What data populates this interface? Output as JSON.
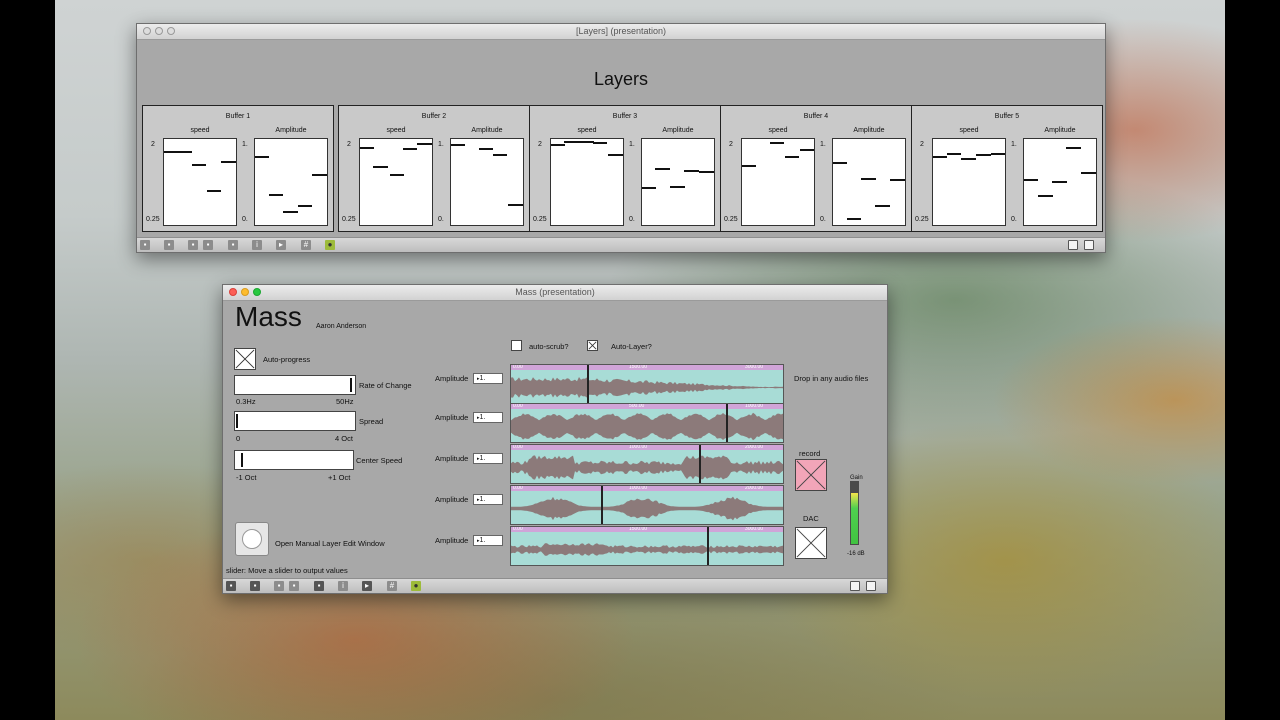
{
  "layers_window": {
    "title": "[Layers] (presentation)",
    "heading": "Layers",
    "buffers": [
      {
        "title": "Buffer 1",
        "speed_label": "speed",
        "amp_label": "Amplitude",
        "speed_max": "2",
        "speed_min": "0.25",
        "amp_max": "1.",
        "amp_min": "0."
      },
      {
        "title": "Buffer 2",
        "speed_label": "speed",
        "amp_label": "Amplitude",
        "speed_max": "2",
        "speed_min": "0.25",
        "amp_max": "1.",
        "amp_min": "0."
      },
      {
        "title": "Buffer 3",
        "speed_label": "speed",
        "amp_label": "Amplitude",
        "speed_max": "2",
        "speed_min": "0.25",
        "amp_max": "1.",
        "amp_min": "0."
      },
      {
        "title": "Buffer 4",
        "speed_label": "speed",
        "amp_label": "Amplitude",
        "speed_max": "2",
        "speed_min": "0.25",
        "amp_max": "1.",
        "amp_min": "0."
      },
      {
        "title": "Buffer 5",
        "speed_label": "speed",
        "amp_label": "Amplitude",
        "speed_max": "2",
        "speed_min": "0.25",
        "amp_max": "1.",
        "amp_min": "0."
      }
    ]
  },
  "mass_window": {
    "title": "Mass (presentation)",
    "heading": "Mass",
    "author": "Aaron Anderson",
    "auto_progress": {
      "label": "Auto-progress",
      "checked": true
    },
    "rate": {
      "label": "Rate of Change",
      "min": "0.3Hz",
      "max": "50Hz",
      "value": 0.98
    },
    "spread": {
      "label": "Spread",
      "min": "0",
      "max": "4 Oct",
      "value": 0.0
    },
    "center": {
      "label": "Center Speed",
      "min": "-1 Oct",
      "max": "+1 Oct",
      "value": 0.04
    },
    "auto_scrub": {
      "label": "auto-scrub?",
      "checked": false
    },
    "auto_layer": {
      "label": "Auto-Layer?",
      "checked": true
    },
    "drop_hint": "Drop in any audio files",
    "tracks": [
      {
        "label": "Amplitude",
        "value": "1.",
        "playhead": 0.28,
        "ticks": [
          "0.00",
          "1500.00",
          "3000.00"
        ]
      },
      {
        "label": "Amplitude",
        "value": "1.",
        "playhead": 0.79,
        "ticks": [
          "0.00",
          "500.00",
          "1000.00"
        ]
      },
      {
        "label": "Amplitude",
        "value": "1.",
        "playhead": 0.69,
        "ticks": [
          "0.00",
          "1000.00",
          "2000.00"
        ]
      },
      {
        "label": "Amplitude",
        "value": "1.",
        "playhead": 0.33,
        "ticks": [
          "0.00",
          "1000.00",
          "2000.00"
        ]
      },
      {
        "label": "Amplitude",
        "value": "1.",
        "playhead": 0.72,
        "ticks": [
          "0.00",
          "1500.00",
          "3000.00"
        ]
      }
    ],
    "record_label": "record",
    "dac_label": "DAC",
    "gain_label": "Gain",
    "gain_readout": "-16 dB",
    "gain_level": 0.82,
    "manual_button_label": "Open Manual Layer Edit Window",
    "status": "slider: Move a slider to output values",
    "colors": {
      "record_bg": "#f2a5b8",
      "wave_bg": "#a8dcd6",
      "ruler": "#d0a4d8",
      "wave": "#8c7a7a"
    }
  }
}
